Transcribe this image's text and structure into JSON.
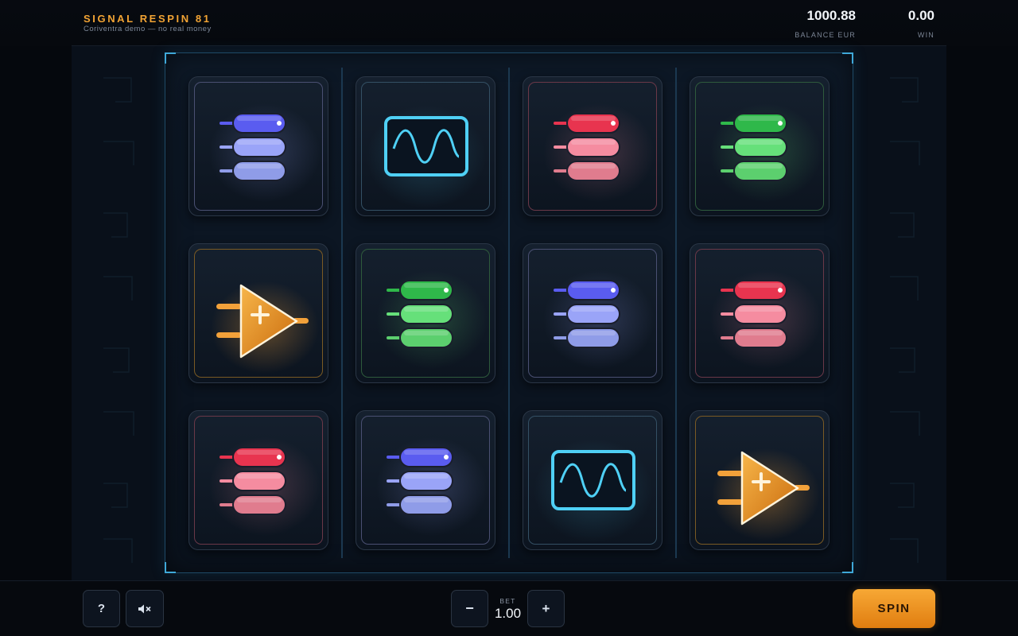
{
  "header": {
    "title": "SIGNAL RESPIN 81",
    "subtitle": "Coriventra demo — no real money",
    "balance_value": "1000.88",
    "balance_label": "BALANCE EUR",
    "win_value": "0.00",
    "win_label": "WIN"
  },
  "grid": [
    [
      "stack-purple",
      "wave-cyan",
      "stack-red",
      "stack-green"
    ],
    [
      "amp-orange",
      "stack-green",
      "stack-purple",
      "stack-red"
    ],
    [
      "stack-red",
      "stack-purple",
      "wave-cyan",
      "amp-orange"
    ]
  ],
  "symbol_colors": {
    "stack-purple": [
      "#5a5cf0",
      "#9aa4f8",
      "#8f9ce8"
    ],
    "stack-red": [
      "#e8344f",
      "#f58ca0",
      "#e07c8e"
    ],
    "stack-green": [
      "#2fb84a",
      "#66e07a",
      "#5ccf6e"
    ],
    "wave-cyan": "#4fd0f5",
    "amp-orange": "#f2a13a"
  },
  "controls": {
    "help_label": "?",
    "mute_icon": "speaker-muted-icon",
    "minus_label": "−",
    "plus_label": "+",
    "bet_label": "BET",
    "bet_value": "1.00",
    "spin_label": "SPIN"
  },
  "colors": {
    "accent": "#f2a434",
    "frame": "#3fa8d8"
  }
}
